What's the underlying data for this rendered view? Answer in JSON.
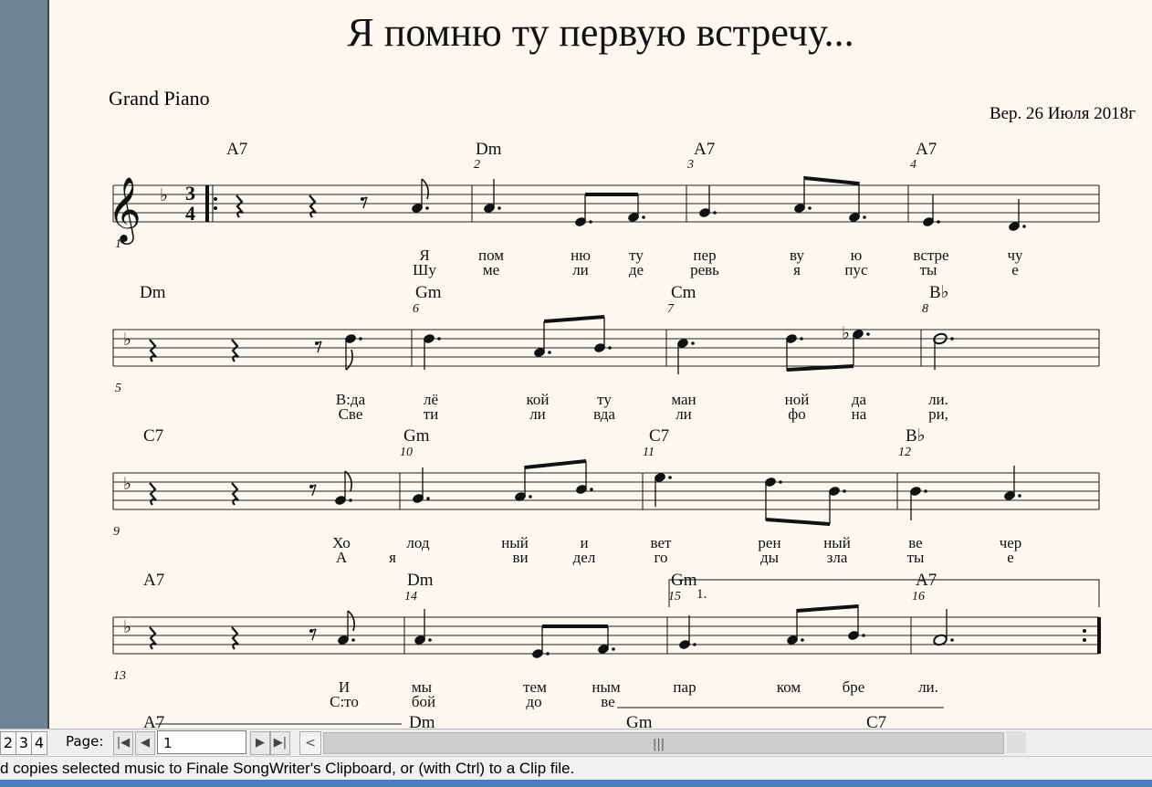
{
  "score": {
    "title": "Я помню ту первую встречу...",
    "instrument": "Grand Piano",
    "version": "Вер. 26 Июля 2018г",
    "time_signature": {
      "top": "3",
      "bottom": "4"
    },
    "systems": [
      {
        "chords": [
          "A7",
          "Dm",
          "A7",
          "A7"
        ],
        "measure_numbers": [
          "1",
          "2",
          "3",
          "4"
        ],
        "lyrics_1": [
          "Я",
          "пом",
          "ню",
          "ту",
          "пер",
          "ву",
          "ю",
          "встре",
          "чу"
        ],
        "lyrics_2": [
          "Шу",
          "ме",
          "ли",
          "де",
          "ревь",
          "я",
          "пус",
          "ты",
          "е"
        ]
      },
      {
        "chords": [
          "Dm",
          "Gm",
          "Cm",
          "B♭"
        ],
        "measure_numbers": [
          "5",
          "6",
          "7",
          "8"
        ],
        "lyrics_1": [
          "В:да",
          "лё",
          "кой",
          "ту",
          "ман",
          "ной",
          "да",
          "ли."
        ],
        "lyrics_2": [
          "Све",
          "ти",
          "ли",
          "вда",
          "ли",
          "фо",
          "на",
          "ри,"
        ]
      },
      {
        "chords": [
          "C7",
          "Gm",
          "C7",
          "B♭"
        ],
        "measure_numbers": [
          "9",
          "10",
          "11",
          "12"
        ],
        "lyrics_1": [
          "Хо",
          "лод",
          "ный",
          "и",
          "вет",
          "рен",
          "ный",
          "ве",
          "чер"
        ],
        "lyrics_2": [
          "А",
          "я",
          "ви",
          "дел",
          "го",
          "ды",
          "зла",
          "ты",
          "е"
        ]
      },
      {
        "chords": [
          "A7",
          "Dm",
          "Gm",
          "A7"
        ],
        "measure_numbers": [
          "13",
          "14",
          "15",
          "16"
        ],
        "ending": "1.",
        "lyrics_1": [
          "И",
          "мы",
          "тем",
          "ным",
          "пар",
          "ком",
          "бре",
          "ли."
        ],
        "lyrics_2": [
          "С:то",
          "бой",
          "до",
          "ве"
        ]
      }
    ],
    "partial_next_chords": [
      "A7",
      "Dm",
      "Gm",
      "C7"
    ]
  },
  "navigation": {
    "page_tabs": [
      "2",
      "3",
      "4"
    ],
    "page_label": "Page:",
    "page_value": "1"
  },
  "status_text": "d copies selected music to Finale SongWriter's Clipboard, or (with Ctrl) to a Clip file."
}
